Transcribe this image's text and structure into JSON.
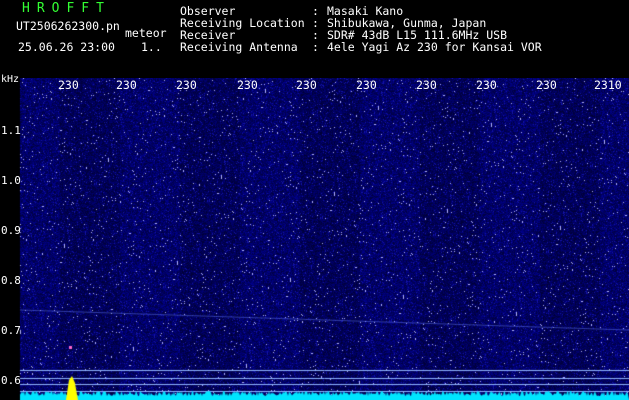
{
  "header": {
    "brand": "HROFFT",
    "filename": "UT2506262300.pn",
    "type": "meteor",
    "datetime": "25.06.26 23:00",
    "count": "1..",
    "rows": [
      {
        "label": "Observer",
        "value": "Masaki Kano"
      },
      {
        "label": "Receiving Location",
        "value": "Shibukawa, Gunma, Japan"
      },
      {
        "label": "Receiver",
        "value": "SDR# 43dB L15 111.6MHz USB"
      },
      {
        "label": "Receiving Antenna",
        "value": "4ele Yagi Az 230 for Kansai VOR"
      }
    ],
    "colon": ":"
  },
  "axes": {
    "y_unit": "kHz",
    "y_ticks": [
      {
        "label": "1.1",
        "value": 1.1
      },
      {
        "label": "1.0",
        "value": 1.0
      },
      {
        "label": "0.9",
        "value": 0.9
      },
      {
        "label": "0.8",
        "value": 0.8
      },
      {
        "label": "0.7",
        "value": 0.7
      },
      {
        "label": "0.6",
        "value": 0.6
      }
    ],
    "x_ticks": [
      "230",
      "230",
      "230",
      "230",
      "230",
      "230",
      "230",
      "230",
      "230",
      "2310"
    ]
  },
  "colors": {
    "background": "#000000",
    "noise": "#0a0a6e",
    "signal_trace": "#00e5ff",
    "meteor_echo": "#ffff00",
    "reference_lines": "#8fb4ff",
    "brand": "#33ff33"
  }
}
